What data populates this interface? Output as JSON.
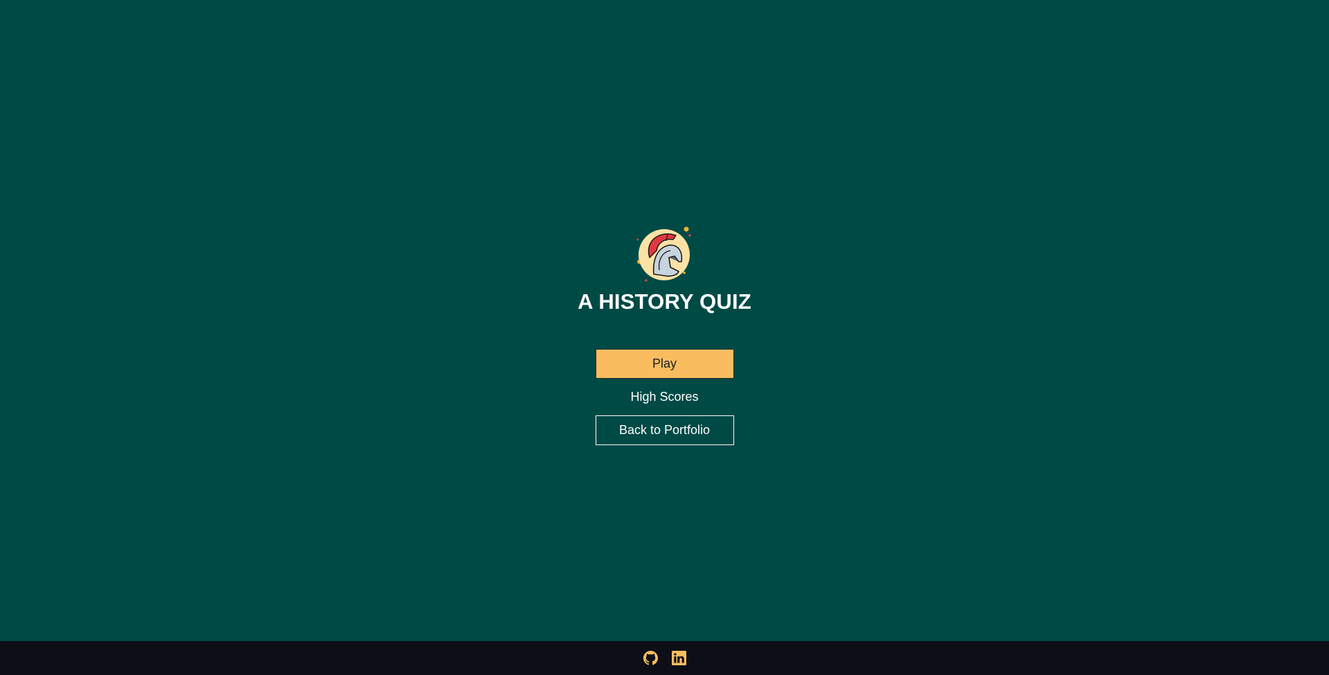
{
  "colors": {
    "background": "#004a46",
    "footer_background": "#0e0e17",
    "accent": "#f9bd60",
    "text": "#ffffff",
    "button_text": "#1c1c1c"
  },
  "header": {
    "logo_icon": "spartan-helmet-icon",
    "title": "A HISTORY QUIZ"
  },
  "menu": {
    "play_label": "Play",
    "high_scores_label": "High Scores",
    "portfolio_label": "Back to Portfolio"
  },
  "footer": {
    "icons": [
      "github-icon",
      "linkedin-icon"
    ]
  }
}
